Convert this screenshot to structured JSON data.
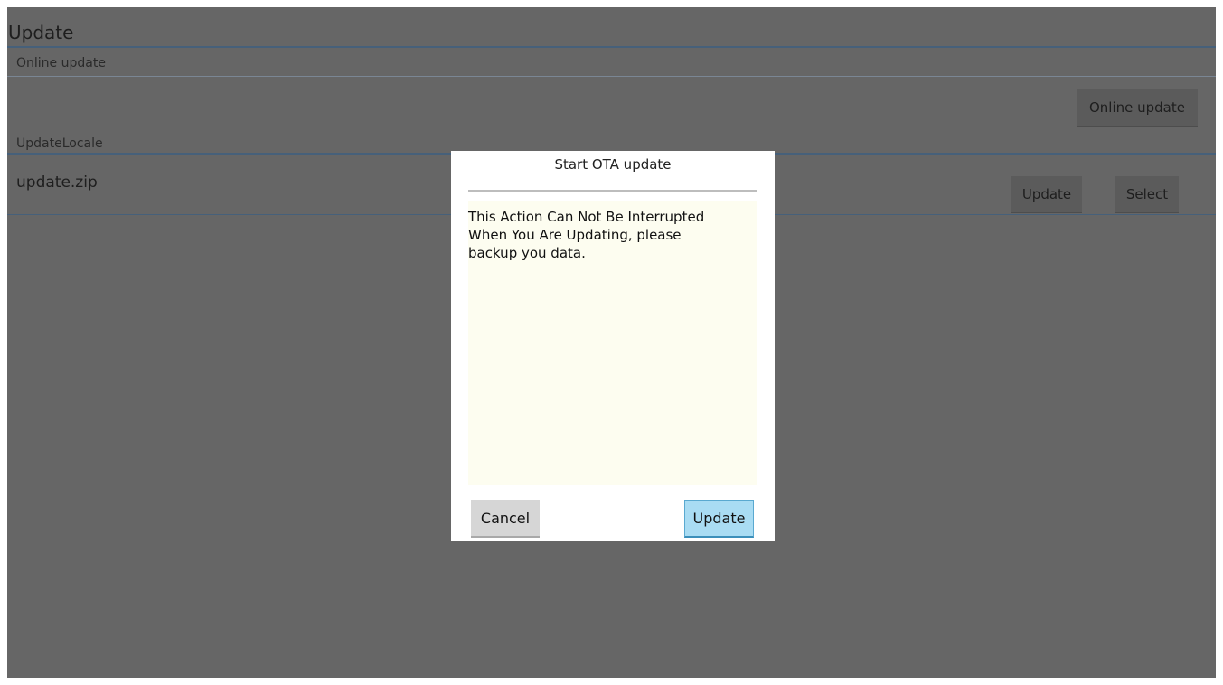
{
  "page": {
    "title": "Update",
    "online_section": {
      "label": "Online update",
      "button_label": "Online update"
    },
    "local_section": {
      "label": "UpdateLocale",
      "file_name": "update.zip",
      "update_button_label": "Update",
      "select_button_label": "Select"
    }
  },
  "dialog": {
    "title": "Start OTA update",
    "message": "This Action Can Not Be Interrupted\nWhen You Are Updating, please\nbackup you data.",
    "cancel_label": "Cancel",
    "confirm_label": "Update"
  },
  "colors": {
    "dim_overlay": "#666666",
    "confirm_button": "#a9dcf3",
    "dialog_body": "#fdfdf0"
  }
}
